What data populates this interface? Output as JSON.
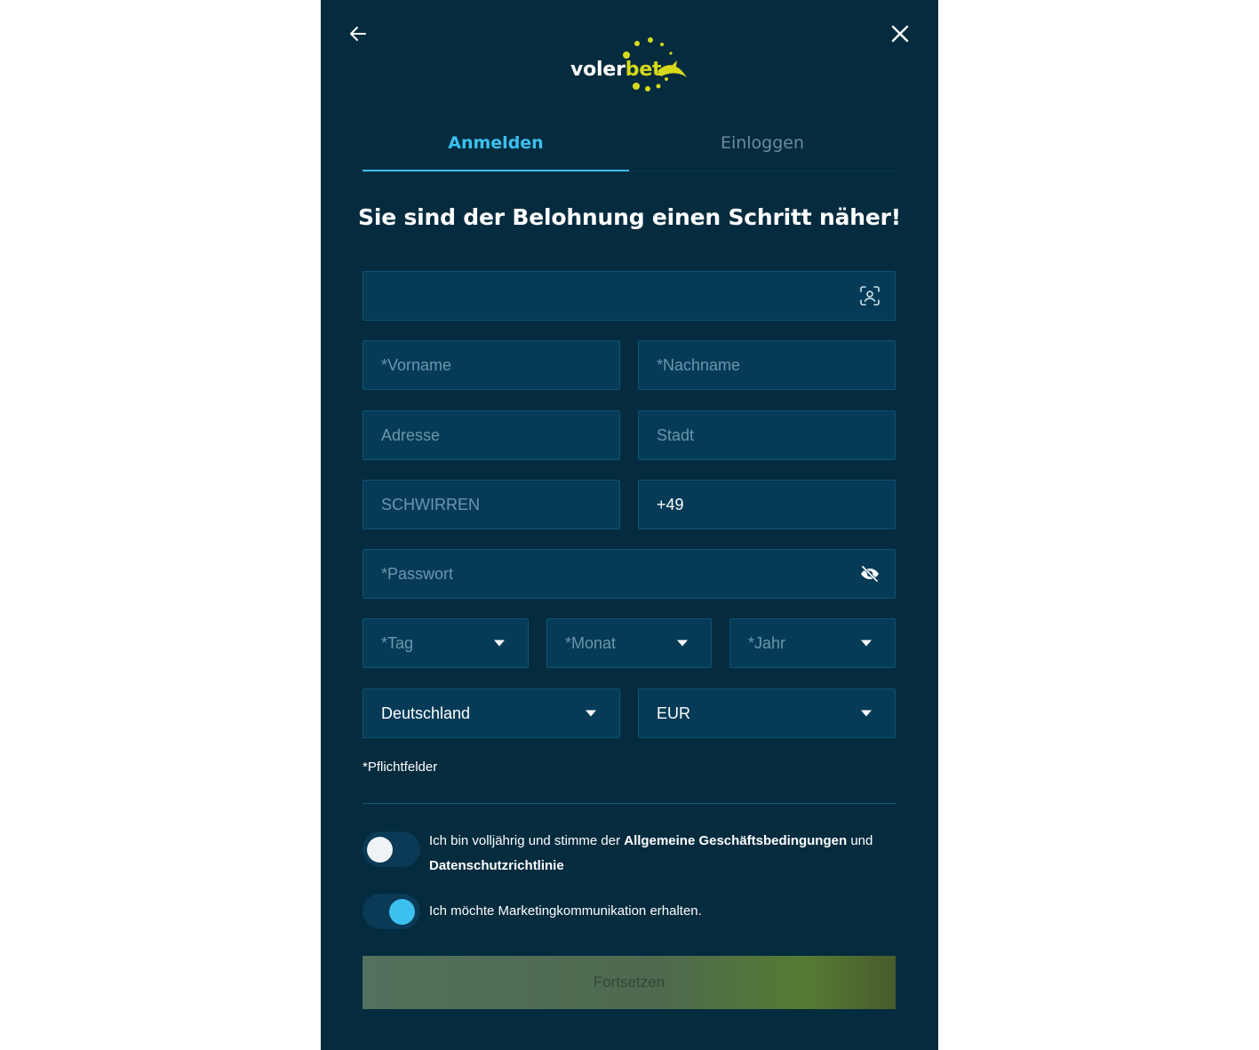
{
  "brand": {
    "name_part1": "voler",
    "name_part2": "bet",
    "accent": "#d7da18"
  },
  "nav": {
    "back_icon": "arrow-left-icon",
    "close_icon": "close-icon"
  },
  "tabs": [
    {
      "label": "Anmelden",
      "active": true
    },
    {
      "label": "Einloggen",
      "active": false
    }
  ],
  "heading": "Sie sind der Belohnung einen Schritt näher!",
  "form": {
    "email": {
      "placeholder": "",
      "value": "",
      "icon": "face-scan-icon"
    },
    "first_name": {
      "placeholder": "*Vorname"
    },
    "last_name": {
      "placeholder": "*Nachname"
    },
    "address": {
      "placeholder": "Adresse"
    },
    "city": {
      "placeholder": "Stadt"
    },
    "promo": {
      "placeholder": "SCHWIRREN"
    },
    "phone": {
      "value": "+49"
    },
    "password": {
      "placeholder": "*Passwort",
      "icon": "eye-off-icon"
    },
    "day": {
      "placeholder": "*Tag"
    },
    "month": {
      "placeholder": "*Monat"
    },
    "year": {
      "placeholder": "*Jahr"
    },
    "country": {
      "value": "Deutschland"
    },
    "currency": {
      "value": "EUR"
    },
    "required_note": "*Pflichtfelder"
  },
  "consent": {
    "age": {
      "text_before": "Ich bin volljährig und stimme der ",
      "terms_link": "Allgemeine Geschäftsbedingungen",
      "text_middle": " und ",
      "privacy_link": "Datenschutzrichtlinie",
      "checked": false
    },
    "marketing": {
      "text": "Ich möchte Marketingkommunikation erhalten.",
      "checked": true
    }
  },
  "submit_label": "Fortsetzen",
  "colors": {
    "background": "#042b3e",
    "field": "#053b57",
    "active_tab": "#3cc0f0"
  }
}
